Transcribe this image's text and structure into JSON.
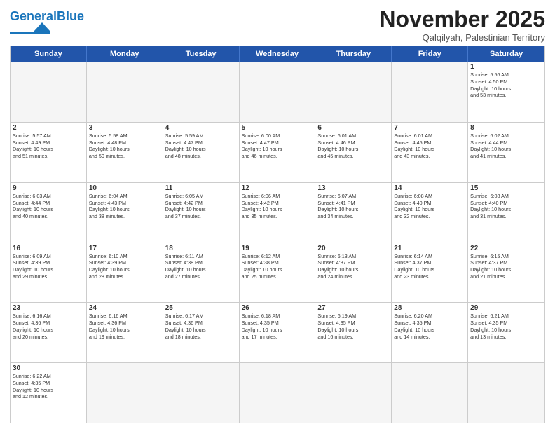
{
  "header": {
    "logo_general": "General",
    "logo_blue": "Blue",
    "month_title": "November 2025",
    "location": "Qalqilyah, Palestinian Territory"
  },
  "days": [
    "Sunday",
    "Monday",
    "Tuesday",
    "Wednesday",
    "Thursday",
    "Friday",
    "Saturday"
  ],
  "weeks": [
    [
      {
        "num": "",
        "info": ""
      },
      {
        "num": "",
        "info": ""
      },
      {
        "num": "",
        "info": ""
      },
      {
        "num": "",
        "info": ""
      },
      {
        "num": "",
        "info": ""
      },
      {
        "num": "",
        "info": ""
      },
      {
        "num": "1",
        "info": "Sunrise: 5:56 AM\nSunset: 4:50 PM\nDaylight: 10 hours\nand 53 minutes."
      }
    ],
    [
      {
        "num": "2",
        "info": "Sunrise: 5:57 AM\nSunset: 4:49 PM\nDaylight: 10 hours\nand 51 minutes."
      },
      {
        "num": "3",
        "info": "Sunrise: 5:58 AM\nSunset: 4:48 PM\nDaylight: 10 hours\nand 50 minutes."
      },
      {
        "num": "4",
        "info": "Sunrise: 5:59 AM\nSunset: 4:47 PM\nDaylight: 10 hours\nand 48 minutes."
      },
      {
        "num": "5",
        "info": "Sunrise: 6:00 AM\nSunset: 4:47 PM\nDaylight: 10 hours\nand 46 minutes."
      },
      {
        "num": "6",
        "info": "Sunrise: 6:01 AM\nSunset: 4:46 PM\nDaylight: 10 hours\nand 45 minutes."
      },
      {
        "num": "7",
        "info": "Sunrise: 6:01 AM\nSunset: 4:45 PM\nDaylight: 10 hours\nand 43 minutes."
      },
      {
        "num": "8",
        "info": "Sunrise: 6:02 AM\nSunset: 4:44 PM\nDaylight: 10 hours\nand 41 minutes."
      }
    ],
    [
      {
        "num": "9",
        "info": "Sunrise: 6:03 AM\nSunset: 4:44 PM\nDaylight: 10 hours\nand 40 minutes."
      },
      {
        "num": "10",
        "info": "Sunrise: 6:04 AM\nSunset: 4:43 PM\nDaylight: 10 hours\nand 38 minutes."
      },
      {
        "num": "11",
        "info": "Sunrise: 6:05 AM\nSunset: 4:42 PM\nDaylight: 10 hours\nand 37 minutes."
      },
      {
        "num": "12",
        "info": "Sunrise: 6:06 AM\nSunset: 4:42 PM\nDaylight: 10 hours\nand 35 minutes."
      },
      {
        "num": "13",
        "info": "Sunrise: 6:07 AM\nSunset: 4:41 PM\nDaylight: 10 hours\nand 34 minutes."
      },
      {
        "num": "14",
        "info": "Sunrise: 6:08 AM\nSunset: 4:40 PM\nDaylight: 10 hours\nand 32 minutes."
      },
      {
        "num": "15",
        "info": "Sunrise: 6:08 AM\nSunset: 4:40 PM\nDaylight: 10 hours\nand 31 minutes."
      }
    ],
    [
      {
        "num": "16",
        "info": "Sunrise: 6:09 AM\nSunset: 4:39 PM\nDaylight: 10 hours\nand 29 minutes."
      },
      {
        "num": "17",
        "info": "Sunrise: 6:10 AM\nSunset: 4:39 PM\nDaylight: 10 hours\nand 28 minutes."
      },
      {
        "num": "18",
        "info": "Sunrise: 6:11 AM\nSunset: 4:38 PM\nDaylight: 10 hours\nand 27 minutes."
      },
      {
        "num": "19",
        "info": "Sunrise: 6:12 AM\nSunset: 4:38 PM\nDaylight: 10 hours\nand 25 minutes."
      },
      {
        "num": "20",
        "info": "Sunrise: 6:13 AM\nSunset: 4:37 PM\nDaylight: 10 hours\nand 24 minutes."
      },
      {
        "num": "21",
        "info": "Sunrise: 6:14 AM\nSunset: 4:37 PM\nDaylight: 10 hours\nand 23 minutes."
      },
      {
        "num": "22",
        "info": "Sunrise: 6:15 AM\nSunset: 4:37 PM\nDaylight: 10 hours\nand 21 minutes."
      }
    ],
    [
      {
        "num": "23",
        "info": "Sunrise: 6:16 AM\nSunset: 4:36 PM\nDaylight: 10 hours\nand 20 minutes."
      },
      {
        "num": "24",
        "info": "Sunrise: 6:16 AM\nSunset: 4:36 PM\nDaylight: 10 hours\nand 19 minutes."
      },
      {
        "num": "25",
        "info": "Sunrise: 6:17 AM\nSunset: 4:36 PM\nDaylight: 10 hours\nand 18 minutes."
      },
      {
        "num": "26",
        "info": "Sunrise: 6:18 AM\nSunset: 4:35 PM\nDaylight: 10 hours\nand 17 minutes."
      },
      {
        "num": "27",
        "info": "Sunrise: 6:19 AM\nSunset: 4:35 PM\nDaylight: 10 hours\nand 16 minutes."
      },
      {
        "num": "28",
        "info": "Sunrise: 6:20 AM\nSunset: 4:35 PM\nDaylight: 10 hours\nand 14 minutes."
      },
      {
        "num": "29",
        "info": "Sunrise: 6:21 AM\nSunset: 4:35 PM\nDaylight: 10 hours\nand 13 minutes."
      }
    ],
    [
      {
        "num": "30",
        "info": "Sunrise: 6:22 AM\nSunset: 4:35 PM\nDaylight: 10 hours\nand 12 minutes."
      },
      {
        "num": "",
        "info": ""
      },
      {
        "num": "",
        "info": ""
      },
      {
        "num": "",
        "info": ""
      },
      {
        "num": "",
        "info": ""
      },
      {
        "num": "",
        "info": ""
      },
      {
        "num": "",
        "info": ""
      }
    ]
  ]
}
